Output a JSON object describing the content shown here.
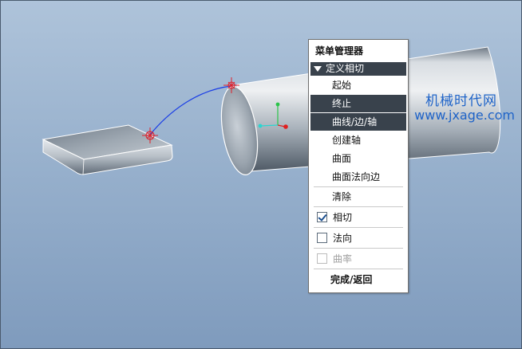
{
  "watermark": {
    "site_name": "机械时代网",
    "url": "www.jxage.com"
  },
  "menu_manager": {
    "title": "菜单管理器",
    "section_label": "定义相切",
    "items": [
      {
        "label": "起始",
        "selected": false
      },
      {
        "label": "终止",
        "selected": true
      },
      {
        "label": "曲线/边/轴",
        "selected": true
      },
      {
        "label": "创建轴",
        "selected": false
      },
      {
        "label": "曲面",
        "selected": false
      },
      {
        "label": "曲面法向边",
        "selected": false
      }
    ],
    "clear_label": "清除",
    "options": [
      {
        "label": "相切",
        "checked": true,
        "enabled": true
      },
      {
        "label": "法向",
        "checked": false,
        "enabled": true
      },
      {
        "label": "曲率",
        "checked": false,
        "enabled": false
      }
    ],
    "done_label": "完成/返回"
  },
  "colors": {
    "menu_highlight": "#39424c",
    "background_top": "#aec3da",
    "background_bottom": "#7f9bbd",
    "curve": "#1a3ee6",
    "datum_point": "#e0202a",
    "watermark": "#1e63c8"
  }
}
